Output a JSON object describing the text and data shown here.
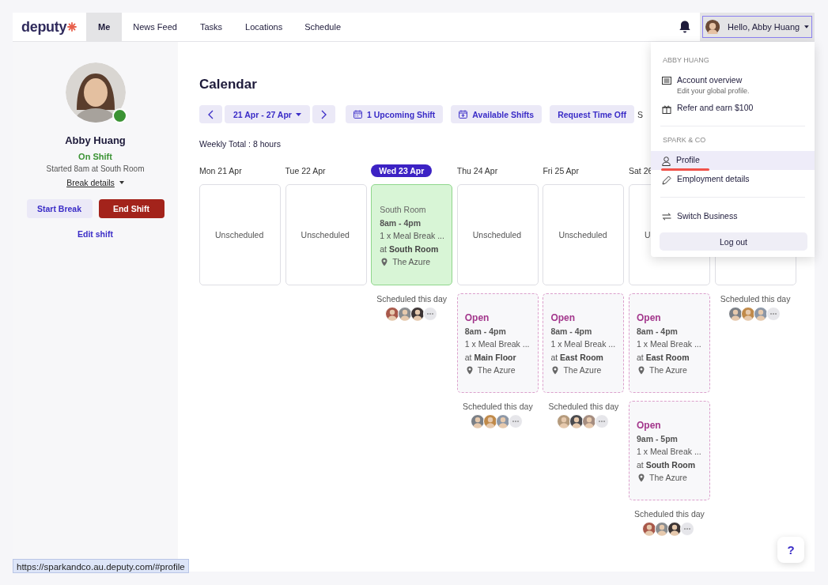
{
  "nav": {
    "logo": "deputy",
    "tabs": [
      {
        "label": "Me",
        "selected": true
      },
      {
        "label": "News Feed",
        "selected": false
      },
      {
        "label": "Tasks",
        "selected": false
      },
      {
        "label": "Locations",
        "selected": false
      },
      {
        "label": "Schedule",
        "selected": false
      }
    ],
    "user_button": "Hello, Abby Huang"
  },
  "profile": {
    "online": true,
    "name": "Abby Huang",
    "status": "On Shift",
    "started": "Started 8am at South Room",
    "break_details": "Break details",
    "buttons": [
      {
        "kind": "secondary",
        "label": "Start Break"
      },
      {
        "kind": "danger",
        "label": "End Shift"
      }
    ],
    "edit_link": "Edit shift"
  },
  "calendar": {
    "title": "Calendar",
    "toolbar": [
      {
        "kind": "prev"
      },
      {
        "kind": "range",
        "label": "21 Apr - 27 Apr"
      },
      {
        "kind": "next"
      },
      {
        "kind": "upcoming",
        "label": "1 Upcoming Shift"
      },
      {
        "kind": "available",
        "label": "Available Shifts"
      },
      {
        "kind": "request",
        "label": "Request Time Off"
      },
      {
        "kind": "cut",
        "label": "S"
      }
    ],
    "weekly_total": "Weekly Total : 8 hours",
    "days": [
      {
        "header": "Mon 21 Apr",
        "selected": false,
        "cards": [
          {
            "kind": "unscheduled",
            "label": "Unscheduled"
          }
        ]
      },
      {
        "header": "Tue 22 Apr",
        "selected": false,
        "cards": [
          {
            "kind": "unscheduled",
            "label": "Unscheduled"
          }
        ]
      },
      {
        "header": "Wed 23 Apr",
        "selected": true,
        "cards": [
          {
            "kind": "shift",
            "area": "South Room",
            "time": "8am - 4pm",
            "breaks": "1 x Meal Break ...",
            "at": "at **South Room**",
            "location": "The Azure"
          }
        ],
        "scheduled": {
          "label": "Scheduled this day",
          "avatars": [
            {
              "kind": "photo"
            },
            {
              "kind": "photo"
            },
            {
              "kind": "photo"
            }
          ]
        }
      },
      {
        "header": "Thu 24 Apr",
        "selected": false,
        "cards": [
          {
            "kind": "unscheduled",
            "label": "Unscheduled"
          },
          {
            "kind": "open",
            "status": "Open",
            "time": "8am - 4pm",
            "breaks": "1 x Meal Break ...",
            "at": "at **Main Floor**",
            "location": "The Azure"
          }
        ],
        "scheduled": {
          "label": "Scheduled this day",
          "avatars": [
            {
              "kind": "photo"
            },
            {
              "kind": "photo"
            },
            {
              "kind": "photo"
            }
          ]
        }
      },
      {
        "header": "Fri 25 Apr",
        "selected": false,
        "cards": [
          {
            "kind": "unscheduled",
            "label": "Unscheduled"
          },
          {
            "kind": "open",
            "status": "Open",
            "time": "8am - 4pm",
            "breaks": "1 x Meal Break ...",
            "at": "at **East Room**",
            "location": "The Azure"
          }
        ],
        "scheduled": {
          "label": "Scheduled this day",
          "avatars": [
            {
              "kind": "photo"
            },
            {
              "kind": "photo"
            },
            {
              "kind": "photo"
            }
          ]
        }
      },
      {
        "header": "Sat 26",
        "selected": false,
        "cards": [
          {
            "kind": "unscheduled",
            "label": "U"
          },
          {
            "kind": "open",
            "status": "Open",
            "time": "8am - 4pm",
            "breaks": "1 x Meal Break ...",
            "at": "at **East Room**",
            "location": "The Azure"
          },
          {
            "kind": "open",
            "status": "Open",
            "time": "9am - 5pm",
            "breaks": "1 x Meal Break ...",
            "at": "at **South Room**",
            "location": "The Azure"
          }
        ],
        "scheduled": {
          "label": "Scheduled this day",
          "avatars": [
            {
              "kind": "photo"
            },
            {
              "kind": "photo"
            },
            {
              "kind": "photo"
            }
          ]
        }
      },
      {
        "cards": [
          {
            "kind": "unscheduled"
          }
        ],
        "scheduled": {
          "label": "Scheduled this day",
          "avatars": [
            {
              "kind": "photo"
            },
            {
              "kind": "photo"
            },
            {
              "kind": "photo"
            }
          ]
        }
      }
    ]
  },
  "menu": {
    "sections": [
      {
        "heading": "ABBY HUANG",
        "items": [
          {
            "label": "Account overview",
            "sublabel": "Edit your global profile.",
            "selected": false
          },
          {
            "label": "Refer and earn $100",
            "selected": false
          }
        ]
      },
      {
        "heading": "SPARK & CO",
        "items": [
          {
            "label": "Profile",
            "selected": true
          },
          {
            "label": "Employment details",
            "selected": false
          }
        ]
      },
      {
        "items": [
          {
            "label": "Switch Business",
            "selected": false
          }
        ]
      }
    ],
    "logout": "Log out"
  },
  "help_button": "?",
  "status_url": "https://sparkandco.au.deputy.com/#profile"
}
